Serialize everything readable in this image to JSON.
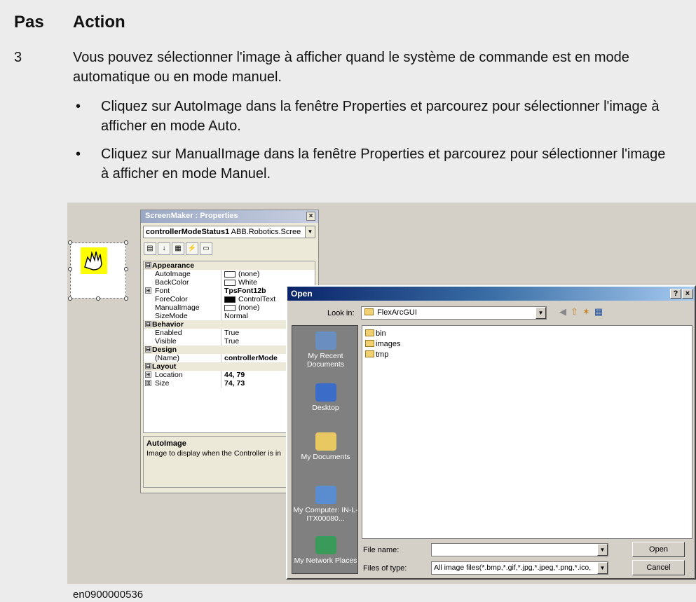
{
  "table": {
    "col_step": "Pas",
    "col_action": "Action",
    "step_number": "3",
    "intro": "Vous pouvez sélectionner l'image à afficher quand le système de commande est en mode automatique ou en mode manuel.",
    "bullets": [
      "Cliquez sur AutoImage dans la fenêtre Properties et parcourez pour sélectionner l'image à afficher en mode Auto.",
      "Cliquez sur ManualImage dans la fenêtre Properties et parcourez pour sélectionner l'image à afficher en mode Manuel."
    ],
    "bullet_glyph": "•",
    "caption": "en0900000536"
  },
  "properties_window": {
    "title": "ScreenMaker : Properties",
    "close_glyph": "×",
    "object_name": "controllerModeStatus1",
    "object_type": "ABB.Robotics.Scree",
    "rows": [
      {
        "type": "cat",
        "key": "Appearance",
        "expander": "⊟"
      },
      {
        "type": "prop",
        "key": "AutoImage",
        "value": "(none)",
        "swatch": "white"
      },
      {
        "type": "prop",
        "key": "BackColor",
        "value": "White",
        "swatch": "white"
      },
      {
        "type": "prop",
        "key": "Font",
        "value": "TpsFont12b",
        "bold": true,
        "expander": "⊞"
      },
      {
        "type": "prop",
        "key": "ForeColor",
        "value": "ControlText",
        "swatch": "black"
      },
      {
        "type": "prop",
        "key": "ManualImage",
        "value": "(none)",
        "swatch": "white"
      },
      {
        "type": "prop",
        "key": "SizeMode",
        "value": "Normal"
      },
      {
        "type": "cat",
        "key": "Behavior",
        "expander": "⊟"
      },
      {
        "type": "prop",
        "key": "Enabled",
        "value": "True"
      },
      {
        "type": "prop",
        "key": "Visible",
        "value": "True"
      },
      {
        "type": "cat",
        "key": "Design",
        "expander": "⊟"
      },
      {
        "type": "prop",
        "key": "(Name)",
        "value": "controllerMode",
        "bold": true
      },
      {
        "type": "cat",
        "key": "Layout",
        "expander": "⊟"
      },
      {
        "type": "prop",
        "key": "Location",
        "value": "44, 79",
        "bold": true,
        "expander": "⊞"
      },
      {
        "type": "prop",
        "key": "Size",
        "value": "74, 73",
        "bold": true,
        "expander": "⊞"
      }
    ],
    "description_title": "AutoImage",
    "description_text": "Image to display when the Controller is in"
  },
  "open_dialog": {
    "title": "Open",
    "help_glyph": "?",
    "close_glyph": "×",
    "look_in_label": "Look in:",
    "look_in_value": "FlexArcGUI",
    "places": [
      "My Recent Documents",
      "Desktop",
      "My Documents",
      "My Computer: IN-L-ITX00080...",
      "My Network Places"
    ],
    "files": [
      "bin",
      "images",
      "tmp"
    ],
    "file_name_label": "File name:",
    "file_name_value": "",
    "file_type_label": "Files of type:",
    "file_type_value": "All image files(*.bmp,*.gif,*.jpg,*.jpeg,*.png,*.ico,",
    "open_button": "Open",
    "cancel_button": "Cancel"
  }
}
